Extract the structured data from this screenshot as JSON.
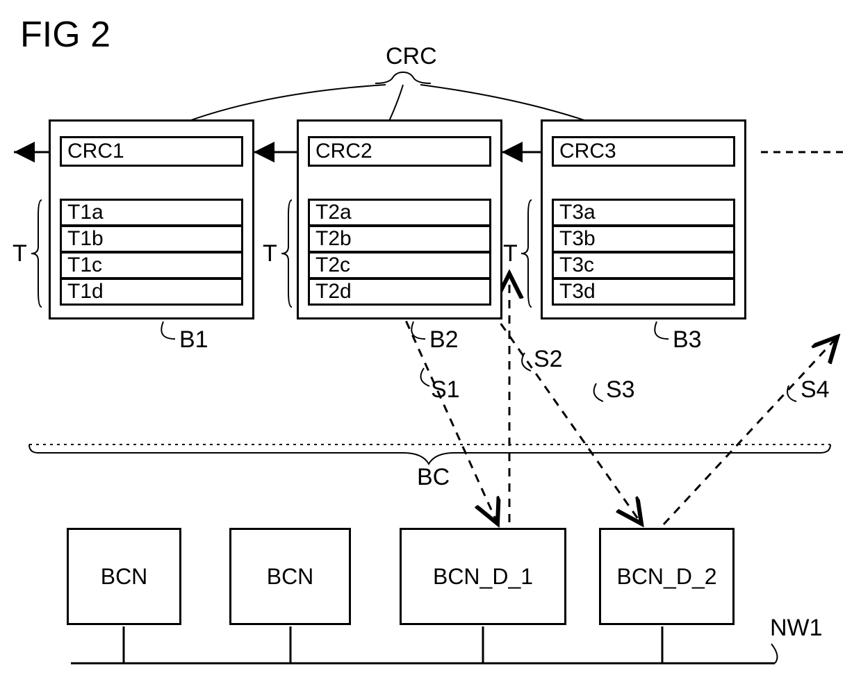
{
  "figure_title": "FIG 2",
  "labels": {
    "crc": "CRC",
    "crc1": "CRC1",
    "crc2": "CRC2",
    "crc3": "CRC3",
    "t": "T",
    "b1": "B1",
    "b2": "B2",
    "b3": "B3",
    "t1a": "T1a",
    "t1b": "T1b",
    "t1c": "T1c",
    "t1d": "T1d",
    "t2a": "T2a",
    "t2b": "T2b",
    "t2c": "T2c",
    "t2d": "T2d",
    "t3a": "T3a",
    "t3b": "T3b",
    "t3c": "T3c",
    "t3d": "T3d",
    "s1": "S1",
    "s2": "S2",
    "s3": "S3",
    "s4": "S4",
    "bc": "BC",
    "bcn": "BCN",
    "bcn_d_1": "BCN_D_1",
    "bcn_d_2": "BCN_D_2",
    "nw1": "NW1"
  }
}
